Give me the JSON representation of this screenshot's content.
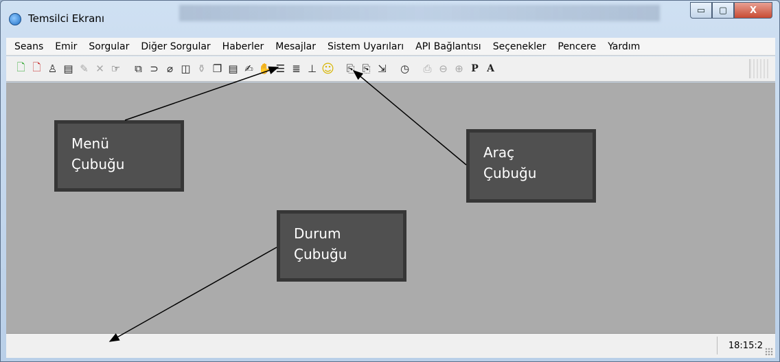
{
  "window": {
    "title": "Temsilci Ekranı",
    "min_label": "▭",
    "max_label": "▢",
    "close_label": "X"
  },
  "menu": [
    "Seans",
    "Emir",
    "Sorgular",
    "Diğer Sorgular",
    "Haberler",
    "Mesajlar",
    "Sistem Uyarıları",
    "API Bağlantısı",
    "Seçenekler",
    "Pencere",
    "Yardım"
  ],
  "toolbar": {
    "icons": [
      {
        "name": "new-order-icon",
        "glyph": "🗋",
        "style": "green"
      },
      {
        "name": "cancel-order-icon",
        "glyph": "🗋",
        "style": "red"
      },
      {
        "name": "user-icon",
        "glyph": "♙",
        "style": ""
      },
      {
        "name": "money-icon",
        "glyph": "▤",
        "style": ""
      },
      {
        "name": "edit-icon",
        "glyph": "✎",
        "style": "dim"
      },
      {
        "name": "delete-icon",
        "glyph": "✕",
        "style": "dim"
      },
      {
        "name": "hand-point-icon",
        "glyph": "☞",
        "style": ""
      },
      {
        "name": "window-icon",
        "glyph": "⧉",
        "style": "",
        "gap": true
      },
      {
        "name": "link-icon",
        "glyph": "⊃",
        "style": ""
      },
      {
        "name": "eraser-icon",
        "glyph": "⌀",
        "style": ""
      },
      {
        "name": "book-icon",
        "glyph": "◫",
        "style": ""
      },
      {
        "name": "bottle-icon",
        "glyph": "⚱",
        "style": "dim"
      },
      {
        "name": "copy-icon",
        "glyph": "❐",
        "style": ""
      },
      {
        "name": "document-icon",
        "glyph": "▤",
        "style": ""
      },
      {
        "name": "writing-icon",
        "glyph": "✍",
        "style": ""
      },
      {
        "name": "hand-stop-icon",
        "glyph": "✋",
        "style": ""
      },
      {
        "name": "list-icon",
        "glyph": "☰",
        "style": ""
      },
      {
        "name": "grid-list-icon",
        "glyph": "≣",
        "style": ""
      },
      {
        "name": "column-icon",
        "glyph": "⊥",
        "style": ""
      },
      {
        "name": "smiley-icon",
        "glyph": "☺",
        "style": "smile"
      },
      {
        "name": "report-icon",
        "glyph": "⎘",
        "style": "",
        "gap": true
      },
      {
        "name": "report2-icon",
        "glyph": "⎘",
        "style": ""
      },
      {
        "name": "export-icon",
        "glyph": "⇲",
        "style": ""
      },
      {
        "name": "clock-icon",
        "glyph": "◷",
        "style": "",
        "gap": true
      },
      {
        "name": "print-icon",
        "glyph": "⎙",
        "style": "dim",
        "gap": true
      },
      {
        "name": "zoom-out-icon",
        "glyph": "⊖",
        "style": "dim"
      },
      {
        "name": "zoom-in-icon",
        "glyph": "⊕",
        "style": "dim"
      },
      {
        "name": "p-button-icon",
        "glyph": "P",
        "style": "bold"
      },
      {
        "name": "a-button-icon",
        "glyph": "A",
        "style": "bold"
      }
    ]
  },
  "status": {
    "time": "18:15:2"
  },
  "callouts": {
    "menu": [
      "Menü",
      "Çubuğu"
    ],
    "toolbar": [
      "Araç",
      "Çubuğu"
    ],
    "status": [
      "Durum",
      "Çubuğu"
    ]
  }
}
